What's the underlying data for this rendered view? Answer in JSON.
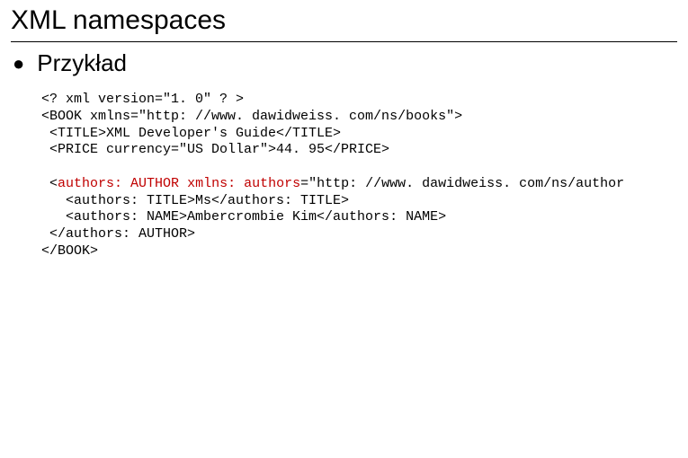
{
  "slide": {
    "title": "XML namespaces",
    "subtitle": "Przykład",
    "code": {
      "l1": "<? xml version=\"1. 0\" ? >",
      "l2": "<BOOK xmlns=\"http: //www. dawidweiss. com/ns/books\">",
      "l3": " <TITLE>XML Developer's Guide</TITLE>",
      "l4": " <PRICE currency=\"US Dollar\">44. 95</PRICE>",
      "l5": "",
      "l6a": " <",
      "l6b": "authors: AUTHOR",
      "l6c": " ",
      "l6d": "xmlns: authors",
      "l6e": "=\"http: //www. dawidweiss. com/ns/author",
      "l7": "   <authors: TITLE>Ms</authors: TITLE>",
      "l8": "   <authors: NAME>Ambercrombie Kim</authors: NAME>",
      "l9": " </authors: AUTHOR>",
      "l10": "</BOOK>"
    }
  }
}
